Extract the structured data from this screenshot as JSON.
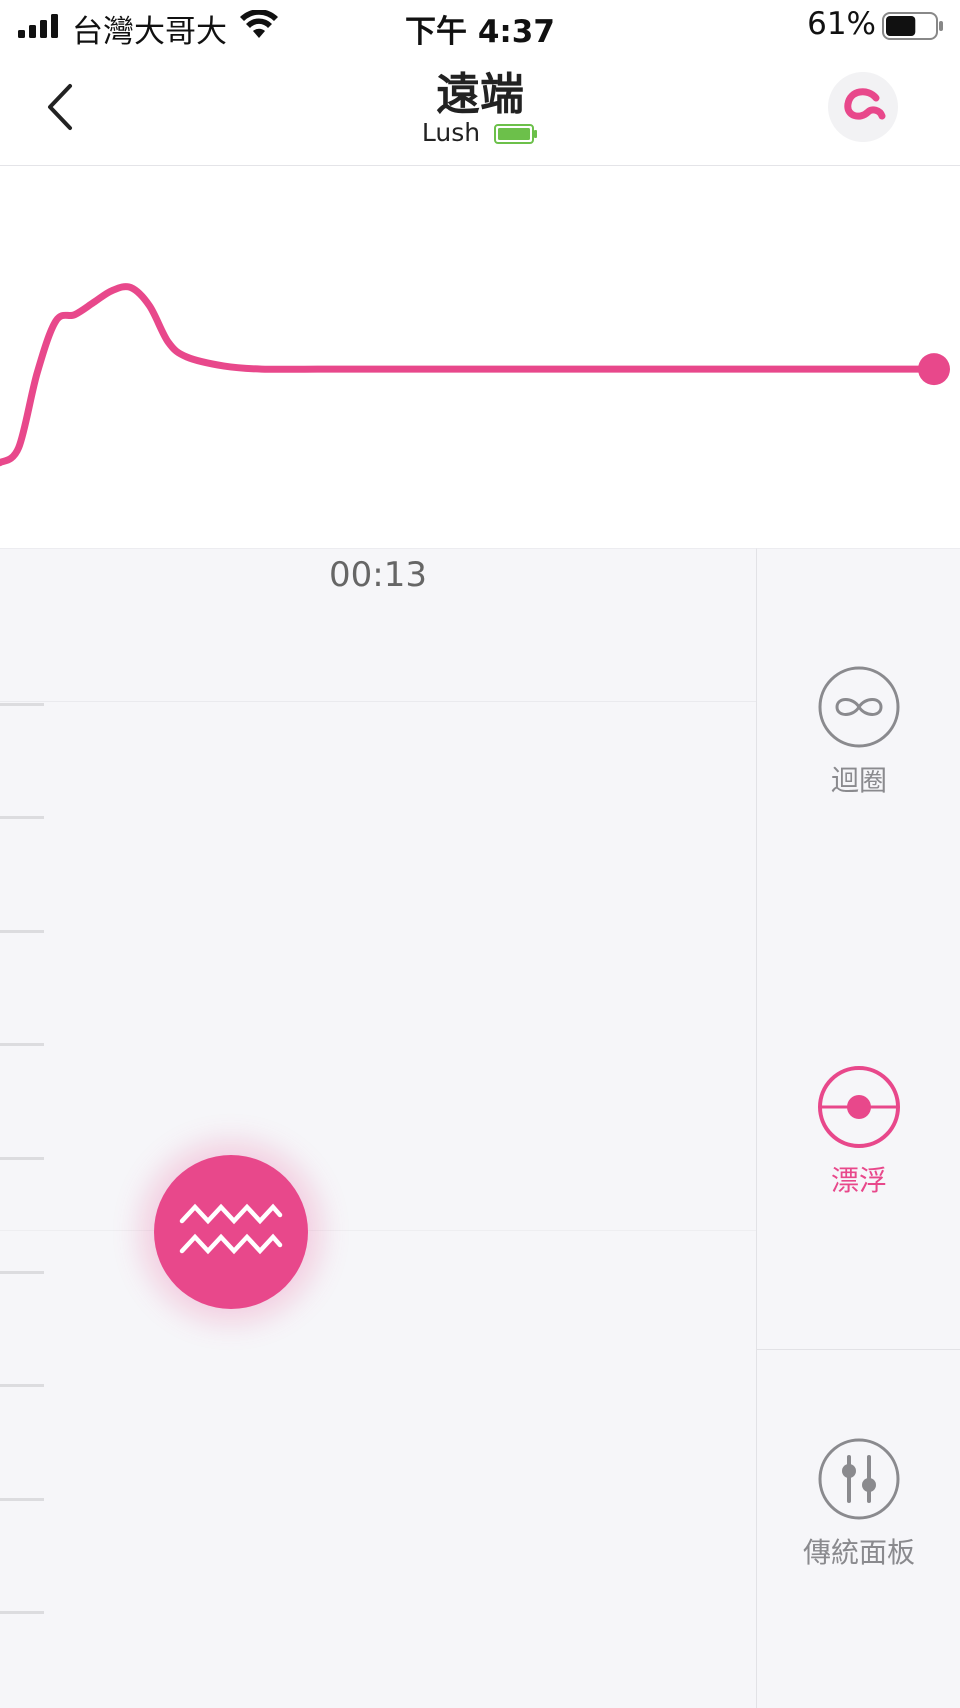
{
  "status_bar": {
    "carrier": "台灣大哥大",
    "time": "下午 4:37",
    "battery_percent": "61%",
    "battery_level": 0.61
  },
  "header": {
    "title": "遠端",
    "device_name": "Lush"
  },
  "timer": "00:13",
  "side_modes": {
    "loop_label": "迴圈",
    "float_label": "漂浮",
    "classic_label": "傳統面板",
    "active": "float"
  },
  "colors": {
    "accent": "#e8488b",
    "inactive": "#8a8a8e",
    "background": "#f6f6f9"
  },
  "icons": {
    "back": "chevron-left-icon",
    "toy": "toy-icon",
    "float_main": "wave-icon",
    "loop": "infinity-icon",
    "float": "float-icon",
    "classic": "sliders-icon"
  },
  "chart_data": {
    "type": "line",
    "title": "",
    "xlabel": "",
    "ylabel": "",
    "x": [
      0,
      2,
      4,
      6,
      8,
      10,
      12,
      14,
      16,
      18,
      20,
      24,
      28,
      34,
      40,
      46,
      52,
      58,
      64,
      70,
      76,
      82,
      88,
      94,
      100
    ],
    "y": [
      0.15,
      0.2,
      0.45,
      0.62,
      0.64,
      0.68,
      0.72,
      0.73,
      0.67,
      0.55,
      0.5,
      0.47,
      0.46,
      0.46,
      0.46,
      0.46,
      0.46,
      0.46,
      0.46,
      0.46,
      0.46,
      0.46,
      0.46,
      0.46,
      0.46
    ],
    "xlim": [
      0,
      100
    ],
    "ylim": [
      0,
      1
    ],
    "grid": false
  }
}
